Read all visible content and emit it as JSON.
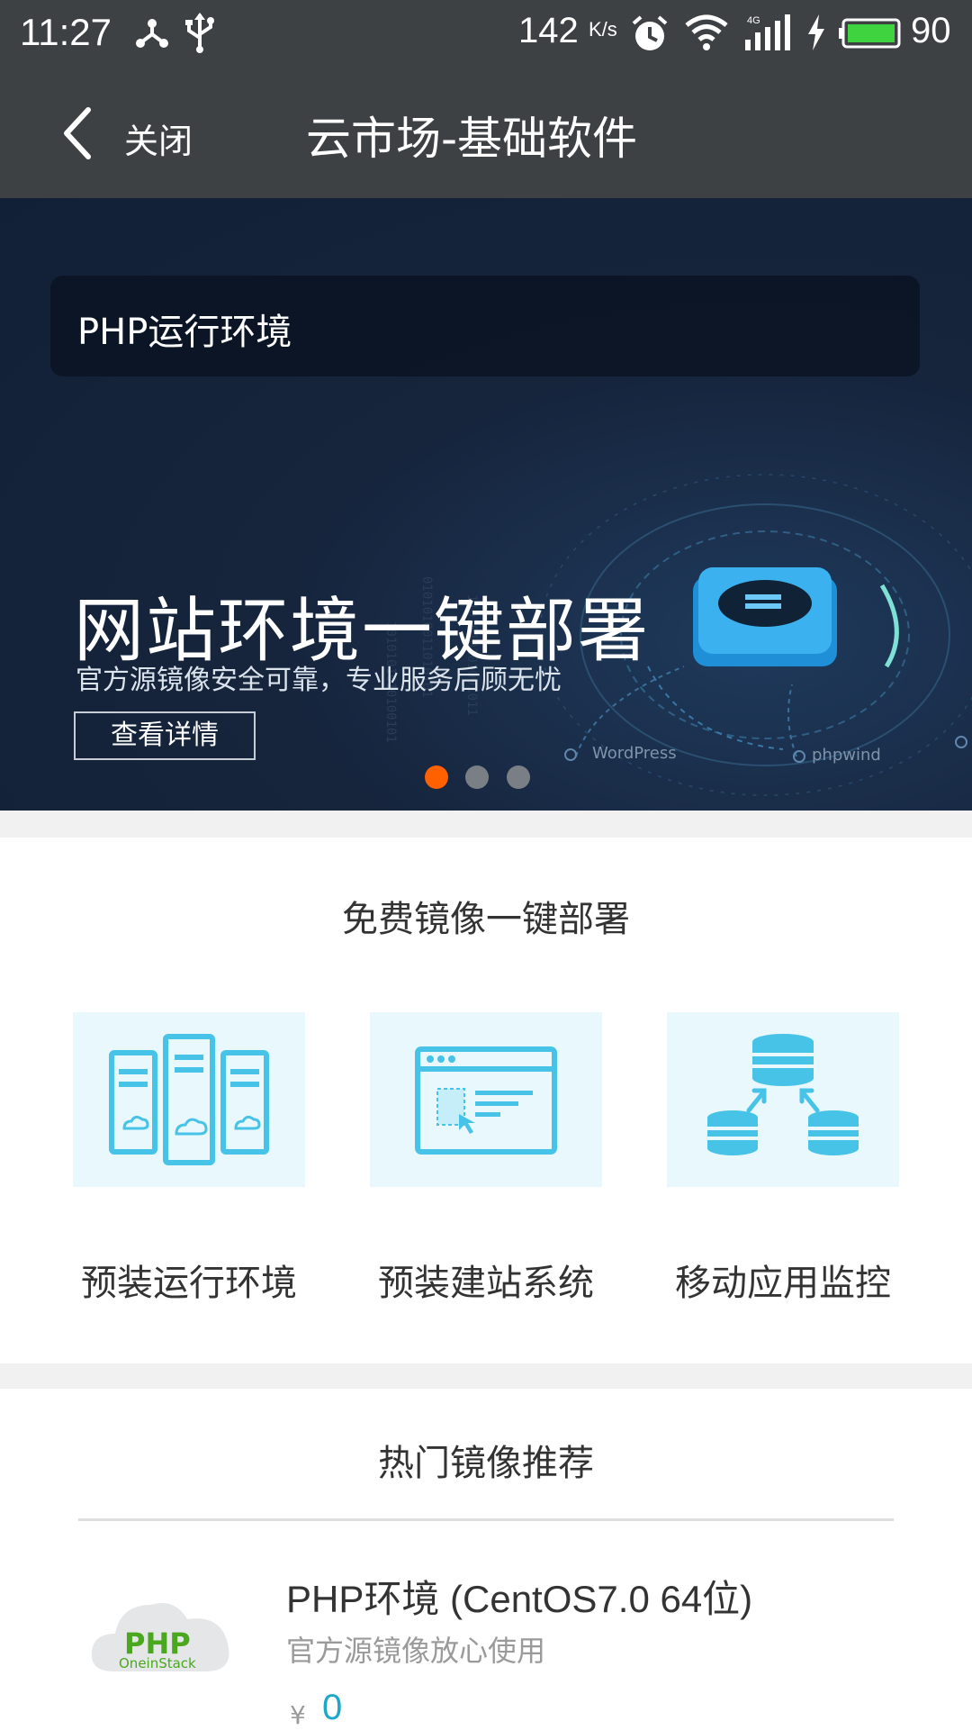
{
  "status_bar": {
    "time": "11:27",
    "network_speed": "142",
    "network_speed_unit": "K/s",
    "battery_level": "90",
    "icons": [
      "network-share-icon",
      "usb-icon",
      "alarm-icon",
      "wifi-icon",
      "signal-4g-icon",
      "charging-icon",
      "battery-icon"
    ]
  },
  "nav": {
    "back_label": "关闭",
    "title": "云市场-基础软件"
  },
  "banner": {
    "notice": "PHP运行环境",
    "headline": "网站环境一键部署",
    "subhead": "官方源镜像安全可靠，专业服务后顾无忧",
    "button_label": "查看详情",
    "logo_labels": [
      "WordPress",
      "phpwind"
    ],
    "carousel": {
      "total": 3,
      "active_index": 0
    },
    "colors": {
      "active_dot": "#ff6000",
      "inactive_dot": "#7a7f86"
    }
  },
  "free_section": {
    "title": "免费镜像一键部署",
    "items": [
      {
        "label": "预装运行环境",
        "icon": "server-cloud-icon"
      },
      {
        "label": "预装建站系统",
        "icon": "browser-window-icon"
      },
      {
        "label": "移动应用监控",
        "icon": "database-sync-icon"
      }
    ],
    "colors": {
      "tile_bg": "#e9f8fd",
      "icon": "#46c3e6"
    }
  },
  "hot_section": {
    "title": "热门镜像推荐",
    "products": [
      {
        "name": "PHP环境 (CentOS7.0 64位)",
        "description": "官方源镜像放心使用",
        "currency": "¥",
        "price": "0",
        "logo_text": "PHP",
        "logo_subtext": "OneinStack"
      }
    ],
    "colors": {
      "price": "#1ea8c8"
    }
  },
  "colors": {
    "header_bg": "#3d4144",
    "banner_bg": "#16243c",
    "page_gap": "#f1f1f1"
  }
}
